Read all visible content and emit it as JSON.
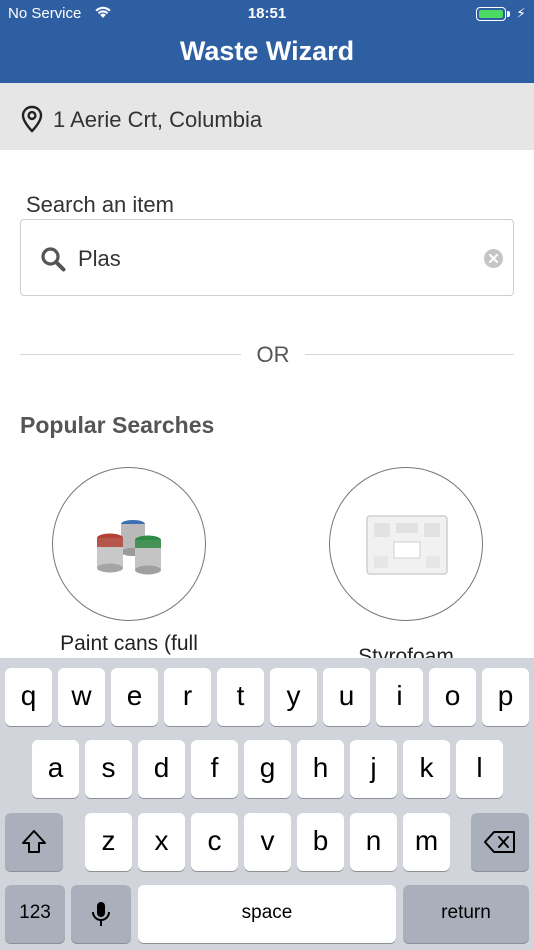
{
  "status_bar": {
    "carrier": "No Service",
    "time": "18:51",
    "wifi_icon": "wifi-icon",
    "battery_color": "#4cd964"
  },
  "header": {
    "title": "Waste Wizard",
    "background": "#2f5fa3"
  },
  "address": {
    "icon": "location-pin-icon",
    "text": "1 Aerie Crt, Columbia"
  },
  "search": {
    "label": "Search an item",
    "value": "Plas",
    "icon": "search-icon",
    "clear_icon": "clear-icon"
  },
  "divider": {
    "text": "OR"
  },
  "popular": {
    "title": "Popular Searches",
    "items": [
      {
        "label": "Paint cans (full",
        "icon": "paint-cans-image"
      },
      {
        "label": "Styrofoam",
        "icon": "styrofoam-image"
      }
    ]
  },
  "keyboard": {
    "row1": [
      "q",
      "w",
      "e",
      "r",
      "t",
      "y",
      "u",
      "i",
      "o",
      "p"
    ],
    "row2": [
      "a",
      "s",
      "d",
      "f",
      "g",
      "h",
      "j",
      "k",
      "l"
    ],
    "row3": [
      "z",
      "x",
      "c",
      "v",
      "b",
      "n",
      "m"
    ],
    "numbers_key": "123",
    "space_key": "space",
    "return_key": "return",
    "shift_icon": "shift-icon",
    "backspace_icon": "backspace-icon",
    "mic_icon": "microphone-icon"
  }
}
